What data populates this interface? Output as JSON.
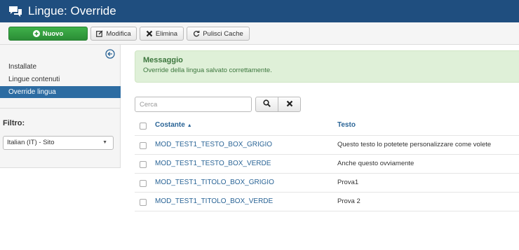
{
  "header": {
    "title": "Lingue: Override",
    "icon": "comments-icon"
  },
  "toolbar": {
    "new_label": "Nuovo",
    "edit_label": "Modifica",
    "delete_label": "Elimina",
    "cache_label": "Pulisci Cache"
  },
  "sidebar": {
    "items": [
      {
        "label": "Installate",
        "active": false
      },
      {
        "label": "Lingue contenuti",
        "active": false
      },
      {
        "label": "Override lingua",
        "active": true
      }
    ],
    "filter_label": "Filtro:",
    "filter_value": "Italian (IT) - Sito"
  },
  "message": {
    "title": "Messaggio",
    "text": "Override della lingua salvato correttamente."
  },
  "search": {
    "placeholder": "Cerca",
    "value": ""
  },
  "table": {
    "col_constant": "Costante",
    "col_text": "Testo",
    "rows": [
      {
        "constant": "MOD_TEST1_TESTO_BOX_GRIGIO",
        "text": "Questo testo lo potetete personalizzare come volete"
      },
      {
        "constant": "MOD_TEST1_TESTO_BOX_VERDE",
        "text": "Anche questo ovviamente"
      },
      {
        "constant": "MOD_TEST1_TITOLO_BOX_GRIGIO",
        "text": "Prova1"
      },
      {
        "constant": "MOD_TEST1_TITOLO_BOX_VERDE",
        "text": "Prova 2"
      }
    ]
  },
  "colors": {
    "header": "#1f4e7f",
    "new_button": "#2e9a38",
    "active_nav": "#2d6ca2",
    "alert_bg": "#dff0d8",
    "link": "#2a6496"
  }
}
